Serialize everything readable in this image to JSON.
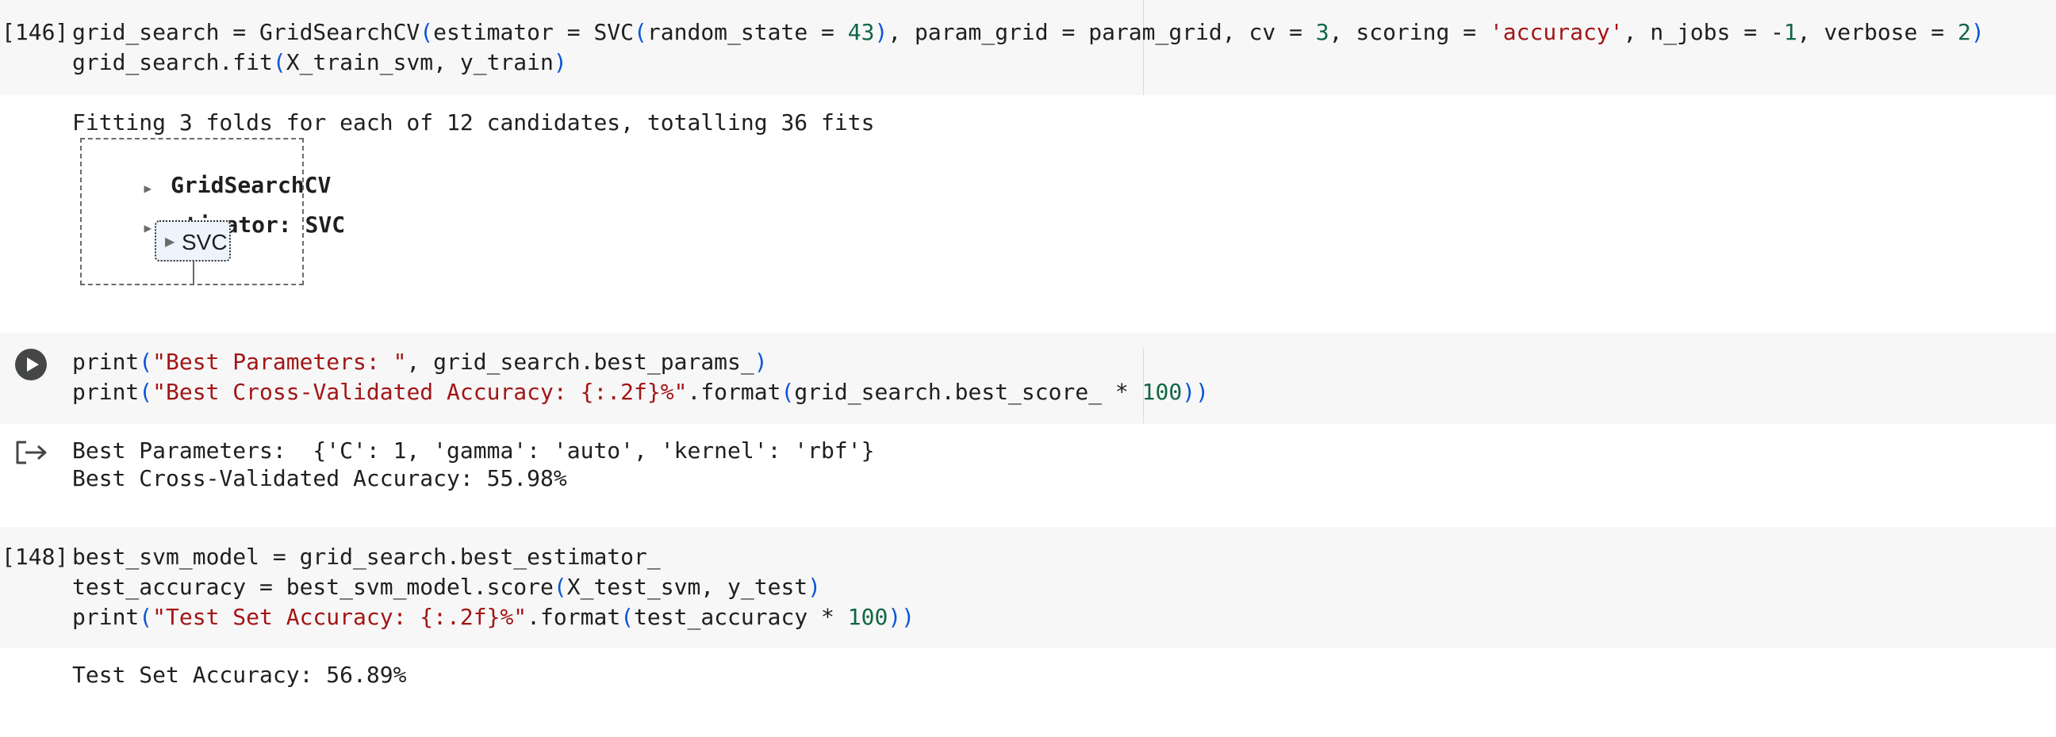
{
  "cells": [
    {
      "execution_count": "[146]",
      "code": [
        "grid_search = GridSearchCV(estimator = SVC(random_state = 43), param_grid = param_grid, cv = 3, scoring = 'accuracy', n_jobs = -1, verbose = 2)",
        "grid_search.fit(X_train_svm, y_train)"
      ],
      "output_text": "Fitting 3 folds for each of 12 candidates, totalling 36 fits",
      "estimator_diagram": {
        "outer_label": "GridSearchCV",
        "estimator_label": "estimator: SVC",
        "inner_label": "SVC"
      }
    },
    {
      "execution_count": "",
      "run_icon": "play-circle-icon",
      "output_icon": "output-arrow-icon",
      "code": [
        "print(\"Best Parameters: \", grid_search.best_params_)",
        "print(\"Best Cross-Validated Accuracy: {:.2f}%\".format(grid_search.best_score_ * 100))"
      ],
      "output": [
        "Best Parameters:  {'C': 1, 'gamma': 'auto', 'kernel': 'rbf'}",
        "Best Cross-Validated Accuracy: 55.98%"
      ]
    },
    {
      "execution_count": "[148]",
      "code": [
        "best_svm_model = grid_search.best_estimator_",
        "test_accuracy = best_svm_model.score(X_test_svm, y_test)",
        "print(\"Test Set Accuracy: {:.2f}%\".format(test_accuracy * 100))"
      ],
      "output": [
        "Test Set Accuracy: 56.89%"
      ]
    }
  ],
  "colors": {
    "code_background": "#f7f7f7",
    "string": "#a31515",
    "number": "#116644",
    "bracket": "#0b55d6",
    "run_button": "#444746"
  }
}
